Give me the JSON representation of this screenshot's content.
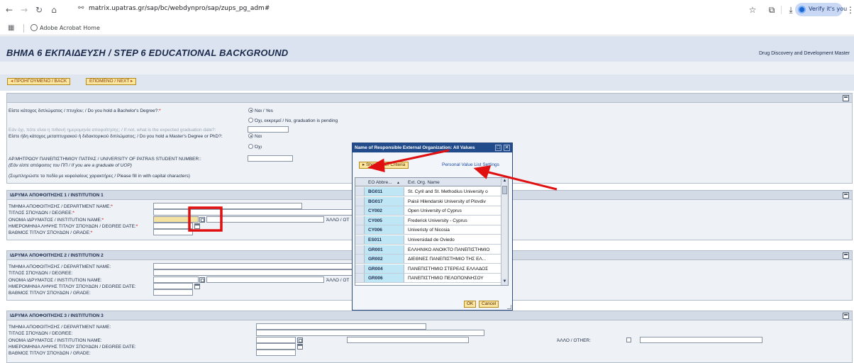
{
  "browser": {
    "url": "matrix.upatras.gr/sap/bc/webdynpro/sap/zups_pg_adm#",
    "verify_label": "Verify it's you",
    "bookmark": "Adobe Acrobat Home",
    "icons": [
      "back-arrow-icon",
      "forward-arrow-icon",
      "reload-icon",
      "home-icon",
      "site-info-icon",
      "star-icon",
      "extensions-icon",
      "download-icon",
      "profile-icon",
      "menu-dots-icon",
      "apps-grid-icon"
    ]
  },
  "header": {
    "title": "ΒΗΜΑ 6 ΕΚΠΑΙΔΕΥΣΗ / STEP 6 EDUCATIONAL BACKGROUND",
    "program": "Drug Discovery and Development Master"
  },
  "nav": {
    "back": "ΠΡΟΗΓΟΥΜΕΝΟ / BACK",
    "next": "ΕΠΟΜΕΝΟ / NEXT"
  },
  "general": {
    "bachelor_q": "Είστε κάτοχος διπλώματος / πτυχίου; / Do you hold a Bachelor's Degree?:",
    "yes": "Ναι / Yes",
    "no_pending": "Όχι, εκκρεμεί / No, graduation is pending",
    "grad_date_q": "Εάν όχι, πότε είναι η πιθανή ημερομηνία αποφοίτησης; / If not, what is the expected graduation date?:",
    "master_q": "Είστε ήδη κάτοχος μεταπτυχιακού ή διδακτορικού διπλώματος; / Do you hold a Master's Degree or PhD?:",
    "nai": "Ναι",
    "oxi": "Όχι",
    "am_label": "ΑΡ.ΜΗΤΡΩΟΥ ΠΑΝΕΠΙΣΤΗΜΙΟΥ ΠΑΤΡΑΣ / UNIVERSITY OF PATRAS STUDENT NUMBER::",
    "am_hint": "(Εάν είστε απόφοιτος του ΠΠ / If you are a graduate of UOP)",
    "caps_note": "(Συμπληρώστε τα πεδία με κεφαλαίους χαρακτήρες / Please fill in with capital characters)"
  },
  "institutions": [
    {
      "title": "ΙΔΡΥΜΑ ΑΠΟΦΟΙΤΗΣΗΣ 1 / INSTITUTION 1",
      "department": "ΤΜΗΜΑ ΑΠΟΦΟΙΤΗΣΗΣ / DEPARTMENT NAME:",
      "degree": "ΤΙΤΛΟΣ ΣΠΟΥΔΩΝ / DEGREE:",
      "institution": "ΟΝΟΜΑ ΙΔΡΥΜΑΤΟΣ / INSTITUTION NAME:",
      "date": "ΗΜΕΡΟΜΗΝΙΑ ΛΗΨΗΣ ΤΙΤΛΟΥ ΣΠΟΥΔΩΝ / DEGREE DATE:",
      "grade": "ΒΑΘΜΟΣ ΤΙΤΛΟΥ ΣΠΟΥΔΩΝ / GRADE:",
      "other": "ΆΛΛΟ / ΟΤ"
    },
    {
      "title": "ΙΔΡΥΜΑ ΑΠΟΦΟΙΤΗΣΗΣ 2 / INSTITUTION 2",
      "department": "ΤΜΗΜΑ ΑΠΟΦΟΙΤΗΣΗΣ / DEPARTMENT NAME:",
      "degree": "ΤΙΤΛΟΣ ΣΠΟΥΔΩΝ / DEGREE:",
      "institution": "ΟΝΟΜΑ ΙΔΡΥΜΑΤΟΣ / INSTITUTION NAME:",
      "date": "ΗΜΕΡΟΜΗΝΙΑ ΛΗΨΗΣ ΤΙΤΛΟΥ ΣΠΟΥΔΩΝ / DEGREE DATE:",
      "grade": "ΒΑΘΜΟΣ ΤΙΤΛΟΥ ΣΠΟΥΔΩΝ / GRADE:",
      "other": "ΆΛΛΟ / ΟΤ"
    },
    {
      "title": "ΙΔΡΥΜΑ ΑΠΟΦΟΙΤΗΣΗΣ 3 / INSTITUTION 3",
      "department": "ΤΜΗΜΑ ΑΠΟΦΟΙΤΗΣΗΣ / DEPARTMENT NAME:",
      "degree": "ΤΙΤΛΟΣ ΣΠΟΥΔΩΝ / DEGREE:",
      "institution": "ΟΝΟΜΑ ΙΔΡΥΜΑΤΟΣ / INSTITUTION NAME:",
      "date": "ΗΜΕΡΟΜΗΝΙΑ ΛΗΨΗΣ ΤΙΤΛΟΥ ΣΠΟΥΔΩΝ / DEGREE DATE:",
      "grade": "ΒΑΘΜΟΣ ΤΙΤΛΟΥ ΣΠΟΥΔΩΝ / GRADE:",
      "other": "ΆΛΛΟ / OTHER:"
    }
  ],
  "dialog": {
    "title": "Name of Responsible External Organization: All Values",
    "show_filter": "Show Filter Criteria",
    "pvls": "Personal Value List Settings",
    "col1": "EO Abbre...",
    "col2": "Ext. Org. Name",
    "rows": [
      {
        "code": "BG011",
        "name": "St. Cyril and St. Methodius University o"
      },
      {
        "code": "BG017",
        "name": "Paisii Hilendarski University of Plovdiv"
      },
      {
        "code": "CY002",
        "name": "Open University of Cyprus"
      },
      {
        "code": "CY005",
        "name": "Frederick University - Cyprus"
      },
      {
        "code": "CY006",
        "name": "Univeristy of Nicosia"
      },
      {
        "code": "ES011",
        "name": "Universidad de Oviedo"
      },
      {
        "code": "GR001",
        "name": "ΕΛΛΗΝΙΚΟ ΑΝΟΙΚΤΟ ΠΑΝΕΠΙΣΤΗΜΙΟ"
      },
      {
        "code": "GR002",
        "name": "ΔΙΕΘΝΕΣ ΠΑΝΕΠΙΣΤΗΜΙΟ ΤΗΣ ΕΛ..."
      },
      {
        "code": "GR004",
        "name": "ΠΑΝΕΠΙΣΤΗΜΙΟ ΣΤΕΡΕΑΣ ΕΛΛΑΔΟΣ"
      },
      {
        "code": "GR006",
        "name": "ΠΑΝΕΠΙΣΤΗΜΙΟ ΠΕΛΟΠΟΝΝΗΣΟΥ"
      }
    ],
    "ok": "OK",
    "cancel": "Cancel"
  },
  "colors": {
    "accent_red": "#e01010",
    "dialog_title": "#224b8b",
    "code_cell": "#bfe6f5",
    "button": "#fbe6a0"
  }
}
